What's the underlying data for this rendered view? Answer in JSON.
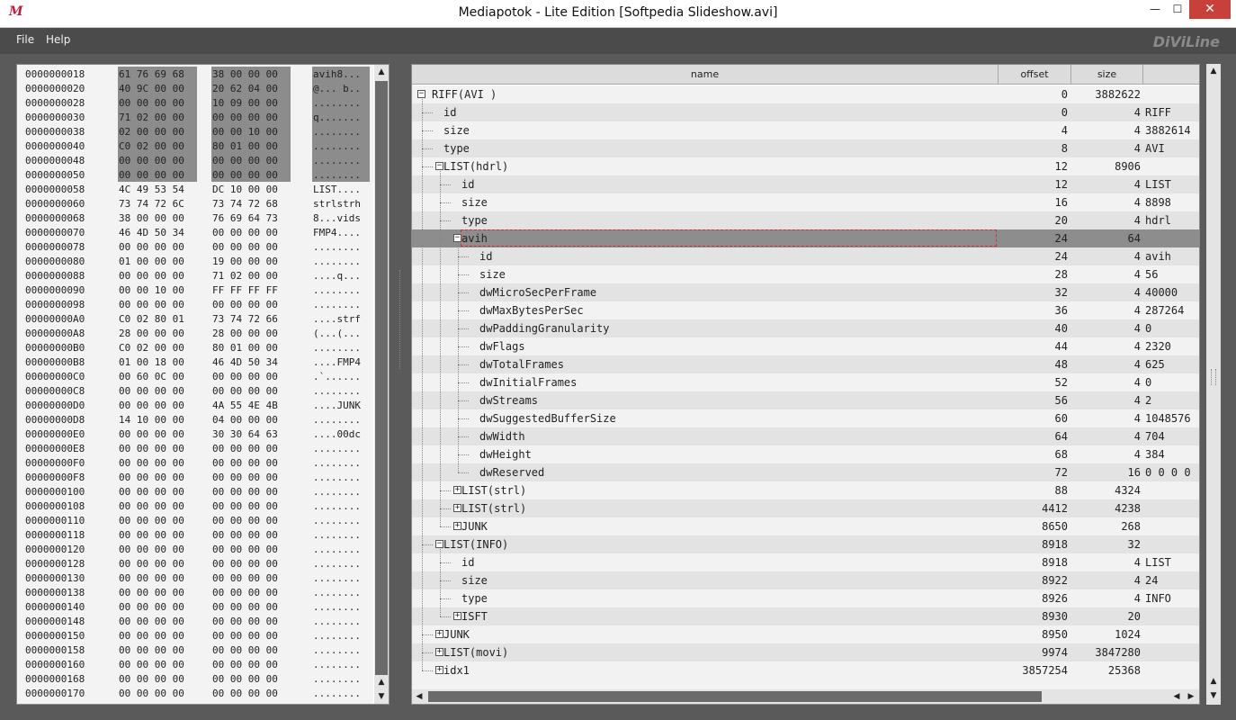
{
  "window": {
    "title": "Mediapotok - Lite Edition [Softpedia Slideshow.avi]",
    "icon_glyph": "M",
    "minimize": "—",
    "maximize": "☐",
    "close": "✕"
  },
  "menu": {
    "items": [
      "File",
      "Help"
    ],
    "logo": "DiViLine"
  },
  "hex": {
    "rows": [
      {
        "addr": "0000000018",
        "b1": "61 76 69 68",
        "b2": "38 00 00 00",
        "ascii": "avih8...",
        "sel": true
      },
      {
        "addr": "0000000020",
        "b1": "40 9C 00 00",
        "b2": "20 62 04 00",
        "ascii": "@... b..",
        "sel": true
      },
      {
        "addr": "0000000028",
        "b1": "00 00 00 00",
        "b2": "10 09 00 00",
        "ascii": "........",
        "sel": true
      },
      {
        "addr": "0000000030",
        "b1": "71 02 00 00",
        "b2": "00 00 00 00",
        "ascii": "q.......",
        "sel": true
      },
      {
        "addr": "0000000038",
        "b1": "02 00 00 00",
        "b2": "00 00 10 00",
        "ascii": "........",
        "sel": true
      },
      {
        "addr": "0000000040",
        "b1": "C0 02 00 00",
        "b2": "80 01 00 00",
        "ascii": "........",
        "sel": true
      },
      {
        "addr": "0000000048",
        "b1": "00 00 00 00",
        "b2": "00 00 00 00",
        "ascii": "........",
        "sel": true
      },
      {
        "addr": "0000000050",
        "b1": "00 00 00 00",
        "b2": "00 00 00 00",
        "ascii": "........",
        "sel": true
      },
      {
        "addr": "0000000058",
        "b1": "4C 49 53 54",
        "b2": "DC 10 00 00",
        "ascii": "LIST...."
      },
      {
        "addr": "0000000060",
        "b1": "73 74 72 6C",
        "b2": "73 74 72 68",
        "ascii": "strlstrh"
      },
      {
        "addr": "0000000068",
        "b1": "38 00 00 00",
        "b2": "76 69 64 73",
        "ascii": "8...vids"
      },
      {
        "addr": "0000000070",
        "b1": "46 4D 50 34",
        "b2": "00 00 00 00",
        "ascii": "FMP4...."
      },
      {
        "addr": "0000000078",
        "b1": "00 00 00 00",
        "b2": "00 00 00 00",
        "ascii": "........"
      },
      {
        "addr": "0000000080",
        "b1": "01 00 00 00",
        "b2": "19 00 00 00",
        "ascii": "........"
      },
      {
        "addr": "0000000088",
        "b1": "00 00 00 00",
        "b2": "71 02 00 00",
        "ascii": "....q..."
      },
      {
        "addr": "0000000090",
        "b1": "00 00 10 00",
        "b2": "FF FF FF FF",
        "ascii": "........"
      },
      {
        "addr": "0000000098",
        "b1": "00 00 00 00",
        "b2": "00 00 00 00",
        "ascii": "........"
      },
      {
        "addr": "00000000A0",
        "b1": "C0 02 80 01",
        "b2": "73 74 72 66",
        "ascii": "....strf"
      },
      {
        "addr": "00000000A8",
        "b1": "28 00 00 00",
        "b2": "28 00 00 00",
        "ascii": "(...(..."
      },
      {
        "addr": "00000000B0",
        "b1": "C0 02 00 00",
        "b2": "80 01 00 00",
        "ascii": "........"
      },
      {
        "addr": "00000000B8",
        "b1": "01 00 18 00",
        "b2": "46 4D 50 34",
        "ascii": "....FMP4"
      },
      {
        "addr": "00000000C0",
        "b1": "00 60 0C 00",
        "b2": "00 00 00 00",
        "ascii": ".`......"
      },
      {
        "addr": "00000000C8",
        "b1": "00 00 00 00",
        "b2": "00 00 00 00",
        "ascii": "........"
      },
      {
        "addr": "00000000D0",
        "b1": "00 00 00 00",
        "b2": "4A 55 4E 4B",
        "ascii": "....JUNK"
      },
      {
        "addr": "00000000D8",
        "b1": "14 10 00 00",
        "b2": "04 00 00 00",
        "ascii": "........"
      },
      {
        "addr": "00000000E0",
        "b1": "00 00 00 00",
        "b2": "30 30 64 63",
        "ascii": "....00dc"
      },
      {
        "addr": "00000000E8",
        "b1": "00 00 00 00",
        "b2": "00 00 00 00",
        "ascii": "........"
      },
      {
        "addr": "00000000F0",
        "b1": "00 00 00 00",
        "b2": "00 00 00 00",
        "ascii": "........"
      },
      {
        "addr": "00000000F8",
        "b1": "00 00 00 00",
        "b2": "00 00 00 00",
        "ascii": "........"
      },
      {
        "addr": "0000000100",
        "b1": "00 00 00 00",
        "b2": "00 00 00 00",
        "ascii": "........"
      },
      {
        "addr": "0000000108",
        "b1": "00 00 00 00",
        "b2": "00 00 00 00",
        "ascii": "........"
      },
      {
        "addr": "0000000110",
        "b1": "00 00 00 00",
        "b2": "00 00 00 00",
        "ascii": "........"
      },
      {
        "addr": "0000000118",
        "b1": "00 00 00 00",
        "b2": "00 00 00 00",
        "ascii": "........"
      },
      {
        "addr": "0000000120",
        "b1": "00 00 00 00",
        "b2": "00 00 00 00",
        "ascii": "........"
      },
      {
        "addr": "0000000128",
        "b1": "00 00 00 00",
        "b2": "00 00 00 00",
        "ascii": "........"
      },
      {
        "addr": "0000000130",
        "b1": "00 00 00 00",
        "b2": "00 00 00 00",
        "ascii": "........"
      },
      {
        "addr": "0000000138",
        "b1": "00 00 00 00",
        "b2": "00 00 00 00",
        "ascii": "........"
      },
      {
        "addr": "0000000140",
        "b1": "00 00 00 00",
        "b2": "00 00 00 00",
        "ascii": "........"
      },
      {
        "addr": "0000000148",
        "b1": "00 00 00 00",
        "b2": "00 00 00 00",
        "ascii": "........"
      },
      {
        "addr": "0000000150",
        "b1": "00 00 00 00",
        "b2": "00 00 00 00",
        "ascii": "........"
      },
      {
        "addr": "0000000158",
        "b1": "00 00 00 00",
        "b2": "00 00 00 00",
        "ascii": "........"
      },
      {
        "addr": "0000000160",
        "b1": "00 00 00 00",
        "b2": "00 00 00 00",
        "ascii": "........"
      },
      {
        "addr": "0000000168",
        "b1": "00 00 00 00",
        "b2": "00 00 00 00",
        "ascii": "........"
      },
      {
        "addr": "0000000170",
        "b1": "00 00 00 00",
        "b2": "00 00 00 00",
        "ascii": "........"
      }
    ]
  },
  "tree": {
    "columns": {
      "name": "name",
      "offset": "offset",
      "size": "size"
    },
    "rows": [
      {
        "name": "RIFF(AVI )",
        "offset": "0",
        "size": "3882622",
        "value": "",
        "depth": 0,
        "toggle": "−"
      },
      {
        "name": "id",
        "offset": "0",
        "size": "4",
        "value": "RIFF",
        "depth": 1
      },
      {
        "name": "size",
        "offset": "4",
        "size": "4",
        "value": "3882614",
        "depth": 1
      },
      {
        "name": "type",
        "offset": "8",
        "size": "4",
        "value": "AVI",
        "depth": 1
      },
      {
        "name": "LIST(hdrl)",
        "offset": "12",
        "size": "8906",
        "value": "",
        "depth": 1,
        "toggle": "−"
      },
      {
        "name": "id",
        "offset": "12",
        "size": "4",
        "value": "LIST",
        "depth": 2
      },
      {
        "name": "size",
        "offset": "16",
        "size": "4",
        "value": "8898",
        "depth": 2
      },
      {
        "name": "type",
        "offset": "20",
        "size": "4",
        "value": "hdrl",
        "depth": 2
      },
      {
        "name": "avih",
        "offset": "24",
        "size": "64",
        "value": "",
        "depth": 2,
        "toggle": "−",
        "selected": true
      },
      {
        "name": "id",
        "offset": "24",
        "size": "4",
        "value": "avih",
        "depth": 3
      },
      {
        "name": "size",
        "offset": "28",
        "size": "4",
        "value": "56",
        "depth": 3
      },
      {
        "name": "dwMicroSecPerFrame",
        "offset": "32",
        "size": "4",
        "value": "40000",
        "depth": 3
      },
      {
        "name": "dwMaxBytesPerSec",
        "offset": "36",
        "size": "4",
        "value": "287264",
        "depth": 3
      },
      {
        "name": "dwPaddingGranularity",
        "offset": "40",
        "size": "4",
        "value": "0",
        "depth": 3
      },
      {
        "name": "dwFlags",
        "offset": "44",
        "size": "4",
        "value": "2320",
        "depth": 3
      },
      {
        "name": "dwTotalFrames",
        "offset": "48",
        "size": "4",
        "value": "625",
        "depth": 3
      },
      {
        "name": "dwInitialFrames",
        "offset": "52",
        "size": "4",
        "value": "0",
        "depth": 3
      },
      {
        "name": "dwStreams",
        "offset": "56",
        "size": "4",
        "value": "2",
        "depth": 3
      },
      {
        "name": "dwSuggestedBufferSize",
        "offset": "60",
        "size": "4",
        "value": "1048576",
        "depth": 3
      },
      {
        "name": "dwWidth",
        "offset": "64",
        "size": "4",
        "value": "704",
        "depth": 3
      },
      {
        "name": "dwHeight",
        "offset": "68",
        "size": "4",
        "value": "384",
        "depth": 3
      },
      {
        "name": "dwReserved",
        "offset": "72",
        "size": "16",
        "value": "0 0 0 0",
        "depth": 3
      },
      {
        "name": "LIST(strl)",
        "offset": "88",
        "size": "4324",
        "value": "",
        "depth": 2,
        "toggle": "+"
      },
      {
        "name": "LIST(strl)",
        "offset": "4412",
        "size": "4238",
        "value": "",
        "depth": 2,
        "toggle": "+"
      },
      {
        "name": "JUNK",
        "offset": "8650",
        "size": "268",
        "value": "",
        "depth": 2,
        "toggle": "+"
      },
      {
        "name": "LIST(INFO)",
        "offset": "8918",
        "size": "32",
        "value": "",
        "depth": 1,
        "toggle": "−"
      },
      {
        "name": "id",
        "offset": "8918",
        "size": "4",
        "value": "LIST",
        "depth": 2
      },
      {
        "name": "size",
        "offset": "8922",
        "size": "4",
        "value": "24",
        "depth": 2
      },
      {
        "name": "type",
        "offset": "8926",
        "size": "4",
        "value": "INFO",
        "depth": 2
      },
      {
        "name": "ISFT",
        "offset": "8930",
        "size": "20",
        "value": "",
        "depth": 2,
        "toggle": "+"
      },
      {
        "name": "JUNK",
        "offset": "8950",
        "size": "1024",
        "value": "",
        "depth": 1,
        "toggle": "+"
      },
      {
        "name": "LIST(movi)",
        "offset": "9974",
        "size": "3847280",
        "value": "",
        "depth": 1,
        "toggle": "+"
      },
      {
        "name": "idx1",
        "offset": "3857254",
        "size": "25368",
        "value": "",
        "depth": 1,
        "toggle": "+"
      }
    ]
  }
}
